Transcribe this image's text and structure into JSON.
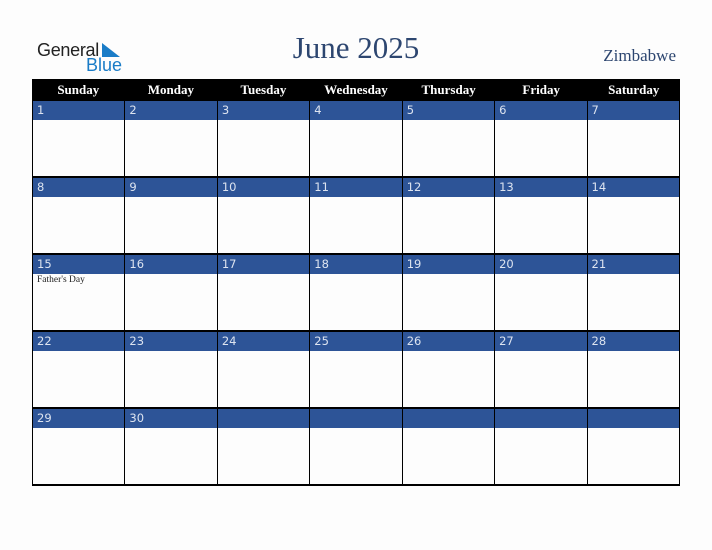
{
  "logo": {
    "line1": "General",
    "line2": "Blue",
    "accent_color": "#1a7cc7"
  },
  "header": {
    "title": "June 2025",
    "country": "Zimbabwe"
  },
  "colors": {
    "header_bg": "#000000",
    "band_bg": "#2d5497",
    "title": "#2d4670"
  },
  "weekdays": [
    "Sunday",
    "Monday",
    "Tuesday",
    "Wednesday",
    "Thursday",
    "Friday",
    "Saturday"
  ],
  "weeks": [
    [
      {
        "day": "1",
        "event": ""
      },
      {
        "day": "2",
        "event": ""
      },
      {
        "day": "3",
        "event": ""
      },
      {
        "day": "4",
        "event": ""
      },
      {
        "day": "5",
        "event": ""
      },
      {
        "day": "6",
        "event": ""
      },
      {
        "day": "7",
        "event": ""
      }
    ],
    [
      {
        "day": "8",
        "event": ""
      },
      {
        "day": "9",
        "event": ""
      },
      {
        "day": "10",
        "event": ""
      },
      {
        "day": "11",
        "event": ""
      },
      {
        "day": "12",
        "event": ""
      },
      {
        "day": "13",
        "event": ""
      },
      {
        "day": "14",
        "event": ""
      }
    ],
    [
      {
        "day": "15",
        "event": "Father's Day"
      },
      {
        "day": "16",
        "event": ""
      },
      {
        "day": "17",
        "event": ""
      },
      {
        "day": "18",
        "event": ""
      },
      {
        "day": "19",
        "event": ""
      },
      {
        "day": "20",
        "event": ""
      },
      {
        "day": "21",
        "event": ""
      }
    ],
    [
      {
        "day": "22",
        "event": ""
      },
      {
        "day": "23",
        "event": ""
      },
      {
        "day": "24",
        "event": ""
      },
      {
        "day": "25",
        "event": ""
      },
      {
        "day": "26",
        "event": ""
      },
      {
        "day": "27",
        "event": ""
      },
      {
        "day": "28",
        "event": ""
      }
    ],
    [
      {
        "day": "29",
        "event": ""
      },
      {
        "day": "30",
        "event": ""
      },
      {
        "day": "",
        "event": ""
      },
      {
        "day": "",
        "event": ""
      },
      {
        "day": "",
        "event": ""
      },
      {
        "day": "",
        "event": ""
      },
      {
        "day": "",
        "event": ""
      }
    ]
  ]
}
